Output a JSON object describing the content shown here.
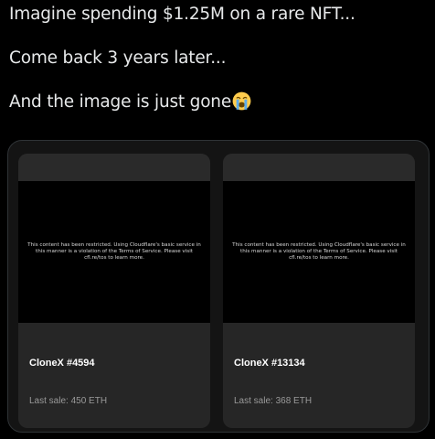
{
  "tweet": {
    "lines": [
      "Imagine spending $1.25M on a rare NFT...",
      "Come back 3 years later...",
      "And the image is just gone"
    ],
    "emoji": "loudly-crying-face-emoji"
  },
  "nft_cards": [
    {
      "restricted_message": "This content has been restricted. Using Cloudflare's basic service in this manner is a violation of the Terms of Service. Please visit cfl.re/tos to learn more.",
      "name": "CloneX #4594",
      "last_sale": "Last sale: 450 ETH"
    },
    {
      "restricted_message": "This content has been restricted. Using Cloudflare's basic service in this manner is a violation of the Terms of Service. Please visit cfl.re/tos to learn more.",
      "name": "CloneX #13134",
      "last_sale": "Last sale: 368 ETH"
    }
  ],
  "colors": {
    "background": "#000000",
    "text": "#e7e9ea",
    "card": "#262626",
    "muted": "#9a9a9a"
  }
}
